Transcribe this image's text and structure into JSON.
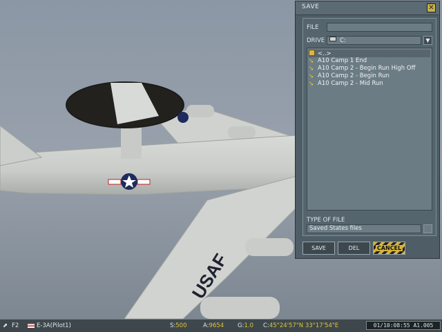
{
  "dialog": {
    "title": "SAVE",
    "close_glyph": "✕",
    "file_label": "FILE",
    "file_value": "",
    "drive_label": "DRIVE",
    "drive_value": "C:",
    "drive_icon": "drive-icon",
    "files": [
      {
        "name": "<..>",
        "icon": "folder-up-icon"
      },
      {
        "name": "A10 Camp 1 End",
        "icon": "file-icon"
      },
      {
        "name": "A10 Camp 2 - Begin Run High Off",
        "icon": "file-icon"
      },
      {
        "name": "A10 Camp 2 - Begin Run",
        "icon": "file-icon"
      },
      {
        "name": "A10 Camp 2 - Mid Run",
        "icon": "file-icon"
      }
    ],
    "type_label": "TYPE OF FILE",
    "type_value": "Saved States files",
    "buttons": {
      "save": "SAVE",
      "del": "DEL",
      "cancel": "CANCEL"
    }
  },
  "statusbar": {
    "view_key": "F2",
    "aircraft": "E-3A(Pilot1)",
    "speed_label": "S:",
    "speed": "500",
    "alt_label": "A:",
    "alt": "9654",
    "g_label": "G:",
    "g": "1.0",
    "coord_label": "C:",
    "coord": "45°24'57\"N  33°17'54\"E",
    "clock": "01/10:08:55 A1.005"
  },
  "colors": {
    "accent": "#e6c533",
    "panel": "#4e5d66",
    "cancel_stripe": "#d4b43a"
  }
}
